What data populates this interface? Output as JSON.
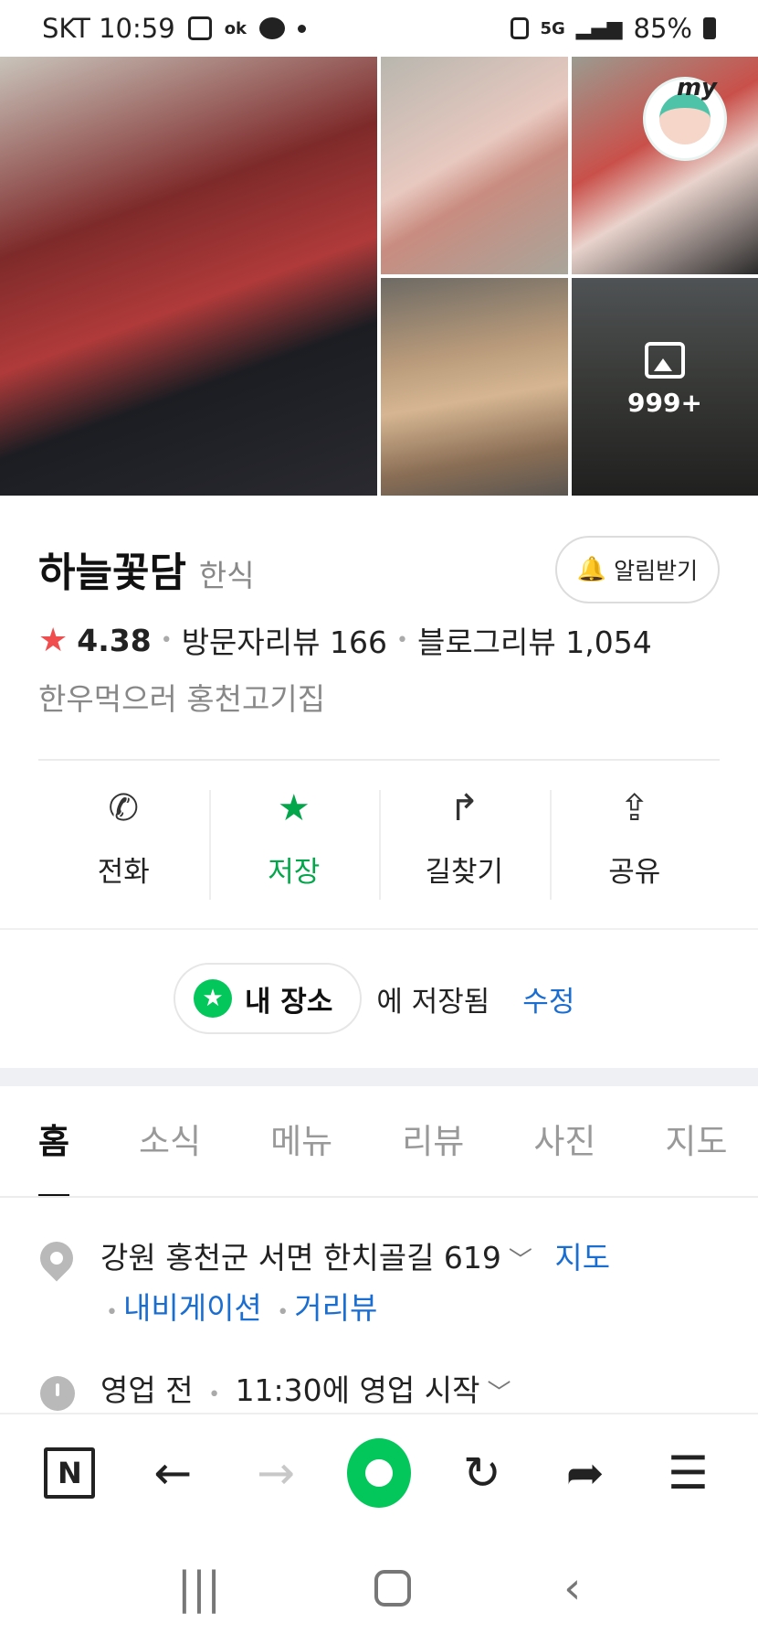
{
  "status_bar": {
    "carrier_time": "SKT 10:59",
    "ok_label": "ok",
    "net_label": "5G",
    "battery": "85%"
  },
  "gallery": {
    "more_count": "999+",
    "my_badge": "my"
  },
  "place": {
    "name": "하늘꽃담",
    "category": "한식",
    "alarm_label": "알림받기",
    "rating": "4.38",
    "visitor_reviews": "방문자리뷰 166",
    "blog_reviews": "블로그리뷰 1,054",
    "description": "한우먹으러 홍천고기집"
  },
  "actions": [
    {
      "label": "전화",
      "icon": "phone-icon"
    },
    {
      "label": "저장",
      "icon": "star-icon"
    },
    {
      "label": "길찾기",
      "icon": "directions-icon"
    },
    {
      "label": "공유",
      "icon": "share-icon"
    }
  ],
  "saved": {
    "list_name": "내 장소",
    "saved_text": "에 저장됨",
    "edit_label": "수정"
  },
  "tabs": [
    "홈",
    "소식",
    "메뉴",
    "리뷰",
    "사진",
    "지도"
  ],
  "info": {
    "address": "강원 홍천군 서면 한치골길 619",
    "map_link": "지도",
    "nav_link": "내비게이션",
    "street_link": "거리뷰",
    "hours_status": "영업 전",
    "hours_detail": "11:30에 영업 시작"
  },
  "browser_bar": {
    "n_label": "N"
  },
  "colors": {
    "accent_green": "#03c75a",
    "link_blue": "#1a6dd1",
    "rating_star": "#f04e4e"
  }
}
